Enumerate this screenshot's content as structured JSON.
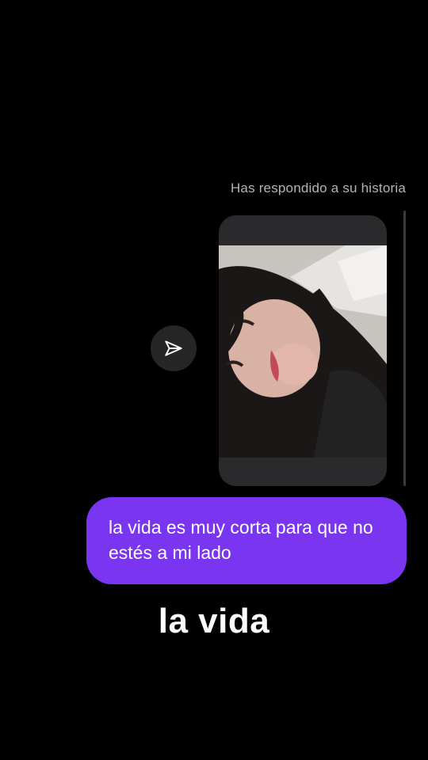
{
  "conversation": {
    "reply_caption": "Has respondido a su historia",
    "message_text": "la vida es muy corta para que no estés a mi lado"
  },
  "story": {
    "image_description_icon": "story-photo"
  },
  "share": {
    "icon": "send-icon"
  },
  "overlay": {
    "caption": "la vida"
  },
  "colors": {
    "background": "#000000",
    "bubble": "#7a35f0",
    "caption_text": "#b4b4b4",
    "card": "#2a2a2c",
    "share_button": "#262626"
  }
}
